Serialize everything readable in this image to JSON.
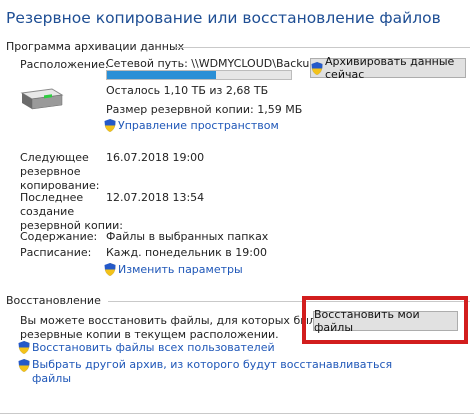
{
  "window": {
    "title": "Резервное копирование или восстановление файлов"
  },
  "backup": {
    "section_label": "Программа архивации данных",
    "location_label": "Расположение:",
    "location_value": "Сетевой путь: \\\\WDMYCLOUD\\Backup",
    "backup_now_button": "Архивировать данные сейчас",
    "progress_used_fraction": 0.59,
    "free_space": "Осталось 1,10 ТБ из 2,68 ТБ",
    "backup_size": "Размер резервной копии: 1,59 МБ",
    "manage_space_link": "Управление пространством",
    "next_backup_label": [
      "Следующее",
      "резервное",
      "копирование:"
    ],
    "next_backup_value": "16.07.2018 19:00",
    "last_backup_label": [
      "Последнее",
      "создание",
      "резервной копии:"
    ],
    "last_backup_value": "12.07.2018 13:54",
    "contents_label": "Содержание:",
    "contents_value": "Файлы в выбранных папках",
    "schedule_label": "Расписание:",
    "schedule_value": "Кажд. понедельник в 19:00",
    "change_settings_link": "Изменить параметры"
  },
  "restore": {
    "section_label": "Восстановление",
    "description": [
      "Вы можете восстановить файлы, для которых были созданы",
      "резервные копии в текущем расположении."
    ],
    "restore_button": "Восстановить мои файлы",
    "restore_all_users_link": "Восстановить файлы всех пользователей",
    "select_other_backup_link": [
      "Выбрать другой архив, из которого будут восстанавливаться",
      "файлы"
    ]
  },
  "colors": {
    "title": "#1e4e94",
    "link": "#1f57b8",
    "progress": "#2a8fd6",
    "highlight_border": "#d21d1d"
  },
  "icons": [
    "drive-icon",
    "shield-icon"
  ]
}
